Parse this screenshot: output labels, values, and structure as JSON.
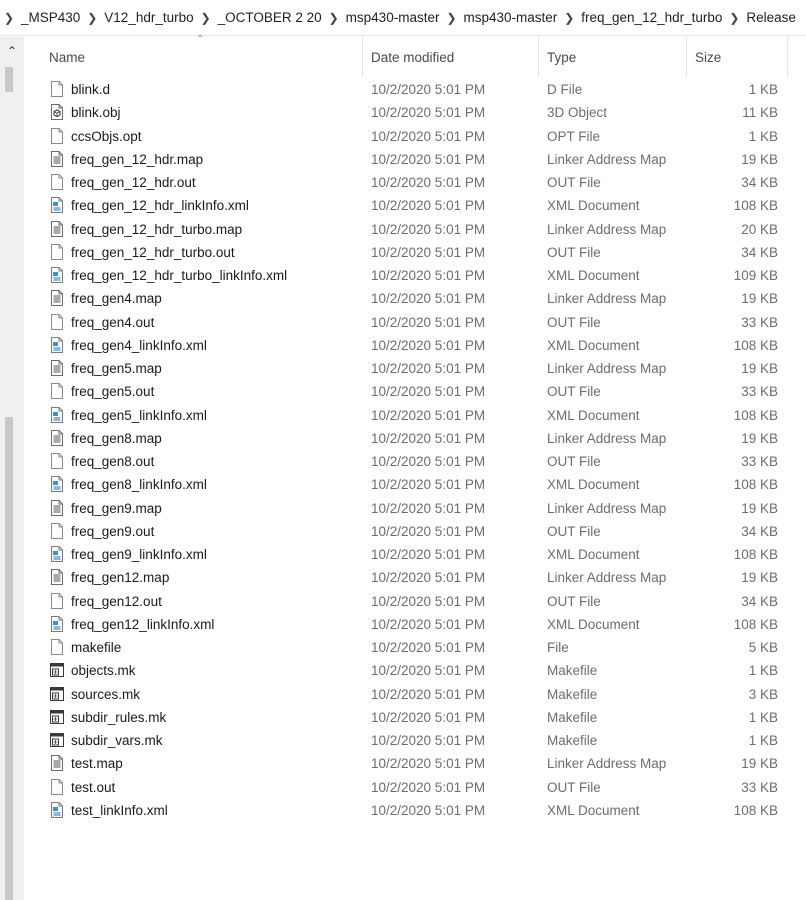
{
  "breadcrumb": [
    "_MSP430",
    "V12_hdr_turbo",
    "_OCTOBER 2 20",
    "msp430-master",
    "msp430-master",
    "freq_gen_12_hdr_turbo",
    "Release"
  ],
  "columns": {
    "name": "Name",
    "date": "Date modified",
    "type": "Type",
    "size": "Size"
  },
  "files": [
    {
      "name": "blink.d",
      "date": "10/2/2020 5:01 PM",
      "type": "D File",
      "size": "1 KB",
      "icon": "blank-file-icon"
    },
    {
      "name": "blink.obj",
      "date": "10/2/2020 5:01 PM",
      "type": "3D Object",
      "size": "11 KB",
      "icon": "3d-object-file-icon"
    },
    {
      "name": "ccsObjs.opt",
      "date": "10/2/2020 5:01 PM",
      "type": "OPT File",
      "size": "1 KB",
      "icon": "blank-file-icon"
    },
    {
      "name": "freq_gen_12_hdr.map",
      "date": "10/2/2020 5:01 PM",
      "type": "Linker Address Map",
      "size": "19 KB",
      "icon": "text-file-icon"
    },
    {
      "name": "freq_gen_12_hdr.out",
      "date": "10/2/2020 5:01 PM",
      "type": "OUT File",
      "size": "34 KB",
      "icon": "blank-file-icon"
    },
    {
      "name": "freq_gen_12_hdr_linkInfo.xml",
      "date": "10/2/2020 5:01 PM",
      "type": "XML Document",
      "size": "108 KB",
      "icon": "xml-file-icon"
    },
    {
      "name": "freq_gen_12_hdr_turbo.map",
      "date": "10/2/2020 5:01 PM",
      "type": "Linker Address Map",
      "size": "20 KB",
      "icon": "text-file-icon"
    },
    {
      "name": "freq_gen_12_hdr_turbo.out",
      "date": "10/2/2020 5:01 PM",
      "type": "OUT File",
      "size": "34 KB",
      "icon": "blank-file-icon"
    },
    {
      "name": "freq_gen_12_hdr_turbo_linkInfo.xml",
      "date": "10/2/2020 5:01 PM",
      "type": "XML Document",
      "size": "109 KB",
      "icon": "xml-file-icon"
    },
    {
      "name": "freq_gen4.map",
      "date": "10/2/2020 5:01 PM",
      "type": "Linker Address Map",
      "size": "19 KB",
      "icon": "text-file-icon"
    },
    {
      "name": "freq_gen4.out",
      "date": "10/2/2020 5:01 PM",
      "type": "OUT File",
      "size": "33 KB",
      "icon": "blank-file-icon"
    },
    {
      "name": "freq_gen4_linkInfo.xml",
      "date": "10/2/2020 5:01 PM",
      "type": "XML Document",
      "size": "108 KB",
      "icon": "xml-file-icon"
    },
    {
      "name": "freq_gen5.map",
      "date": "10/2/2020 5:01 PM",
      "type": "Linker Address Map",
      "size": "19 KB",
      "icon": "text-file-icon"
    },
    {
      "name": "freq_gen5.out",
      "date": "10/2/2020 5:01 PM",
      "type": "OUT File",
      "size": "33 KB",
      "icon": "blank-file-icon"
    },
    {
      "name": "freq_gen5_linkInfo.xml",
      "date": "10/2/2020 5:01 PM",
      "type": "XML Document",
      "size": "108 KB",
      "icon": "xml-file-icon"
    },
    {
      "name": "freq_gen8.map",
      "date": "10/2/2020 5:01 PM",
      "type": "Linker Address Map",
      "size": "19 KB",
      "icon": "text-file-icon"
    },
    {
      "name": "freq_gen8.out",
      "date": "10/2/2020 5:01 PM",
      "type": "OUT File",
      "size": "33 KB",
      "icon": "blank-file-icon"
    },
    {
      "name": "freq_gen8_linkInfo.xml",
      "date": "10/2/2020 5:01 PM",
      "type": "XML Document",
      "size": "108 KB",
      "icon": "xml-file-icon"
    },
    {
      "name": "freq_gen9.map",
      "date": "10/2/2020 5:01 PM",
      "type": "Linker Address Map",
      "size": "19 KB",
      "icon": "text-file-icon"
    },
    {
      "name": "freq_gen9.out",
      "date": "10/2/2020 5:01 PM",
      "type": "OUT File",
      "size": "34 KB",
      "icon": "blank-file-icon"
    },
    {
      "name": "freq_gen9_linkInfo.xml",
      "date": "10/2/2020 5:01 PM",
      "type": "XML Document",
      "size": "108 KB",
      "icon": "xml-file-icon"
    },
    {
      "name": "freq_gen12.map",
      "date": "10/2/2020 5:01 PM",
      "type": "Linker Address Map",
      "size": "19 KB",
      "icon": "text-file-icon"
    },
    {
      "name": "freq_gen12.out",
      "date": "10/2/2020 5:01 PM",
      "type": "OUT File",
      "size": "34 KB",
      "icon": "blank-file-icon"
    },
    {
      "name": "freq_gen12_linkInfo.xml",
      "date": "10/2/2020 5:01 PM",
      "type": "XML Document",
      "size": "108 KB",
      "icon": "xml-file-icon"
    },
    {
      "name": "makefile",
      "date": "10/2/2020 5:01 PM",
      "type": "File",
      "size": "5 KB",
      "icon": "blank-file-icon"
    },
    {
      "name": "objects.mk",
      "date": "10/2/2020 5:01 PM",
      "type": "Makefile",
      "size": "1 KB",
      "icon": "makefile-icon"
    },
    {
      "name": "sources.mk",
      "date": "10/2/2020 5:01 PM",
      "type": "Makefile",
      "size": "3 KB",
      "icon": "makefile-icon"
    },
    {
      "name": "subdir_rules.mk",
      "date": "10/2/2020 5:01 PM",
      "type": "Makefile",
      "size": "1 KB",
      "icon": "makefile-icon"
    },
    {
      "name": "subdir_vars.mk",
      "date": "10/2/2020 5:01 PM",
      "type": "Makefile",
      "size": "1 KB",
      "icon": "makefile-icon"
    },
    {
      "name": "test.map",
      "date": "10/2/2020 5:01 PM",
      "type": "Linker Address Map",
      "size": "19 KB",
      "icon": "text-file-icon"
    },
    {
      "name": "test.out",
      "date": "10/2/2020 5:01 PM",
      "type": "OUT File",
      "size": "33 KB",
      "icon": "blank-file-icon"
    },
    {
      "name": "test_linkInfo.xml",
      "date": "10/2/2020 5:01 PM",
      "type": "XML Document",
      "size": "108 KB",
      "icon": "xml-file-icon"
    }
  ]
}
